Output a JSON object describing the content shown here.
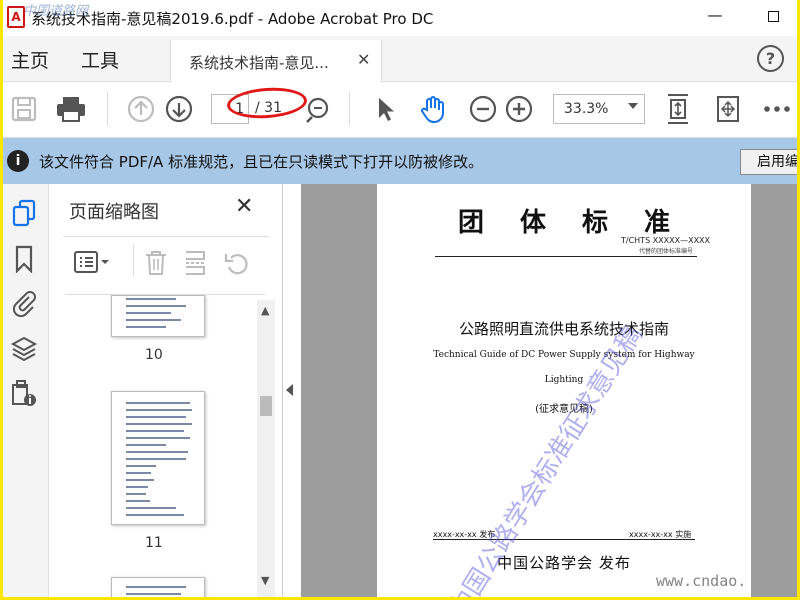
{
  "window": {
    "title": "系统技术指南-意见稿2019.6.pdf - Adobe Acrobat Pro DC",
    "app_icon_glyph": "A",
    "overlay_watermark": "中国道路网",
    "minimize_glyph": "—",
    "close_glyph": "✕"
  },
  "menubar": {
    "home": "主页",
    "tools": "工具",
    "tab_label": "系统技术指南-意见...",
    "tab_close_glyph": "✕",
    "help_glyph": "?"
  },
  "toolbar": {
    "current_page": "1",
    "total_pages": "/ 31",
    "zoom": "33.3%"
  },
  "infobar": {
    "icon_glyph": "i",
    "message": "该文件符合 PDF/A 标准规范，且已在只读模式下打开以防被修改。",
    "enable_button": "启用编辑"
  },
  "thumbnails": {
    "title": "页面缩略图",
    "close_glyph": "✕",
    "pages": [
      {
        "label": "10"
      },
      {
        "label": "11"
      }
    ]
  },
  "document": {
    "heading": "团体标准",
    "code": "T/CHTS XXXXX—XXXX",
    "code_note": "代替的团体标准编号",
    "title_cn": "公路照明直流供电系统技术指南",
    "title_en_line1": "Technical Guide of DC Power Supply system for Highway",
    "title_en_line2": "Lighting",
    "draft_note": "(征求意见稿)",
    "issue_date": "xxxx-xx-xx 发布",
    "implement_date": "xxxx-xx-xx 实施",
    "publisher": "中国公路学会  发布",
    "watermark": "中国公路学会标准征求意见稿"
  },
  "site_watermark": "www.cndao.",
  "colors": {
    "frame_border": "#ffe600",
    "infobar_bg": "#a7c7e7",
    "accent_blue": "#1473e6",
    "annotation_red": "#e01818"
  }
}
